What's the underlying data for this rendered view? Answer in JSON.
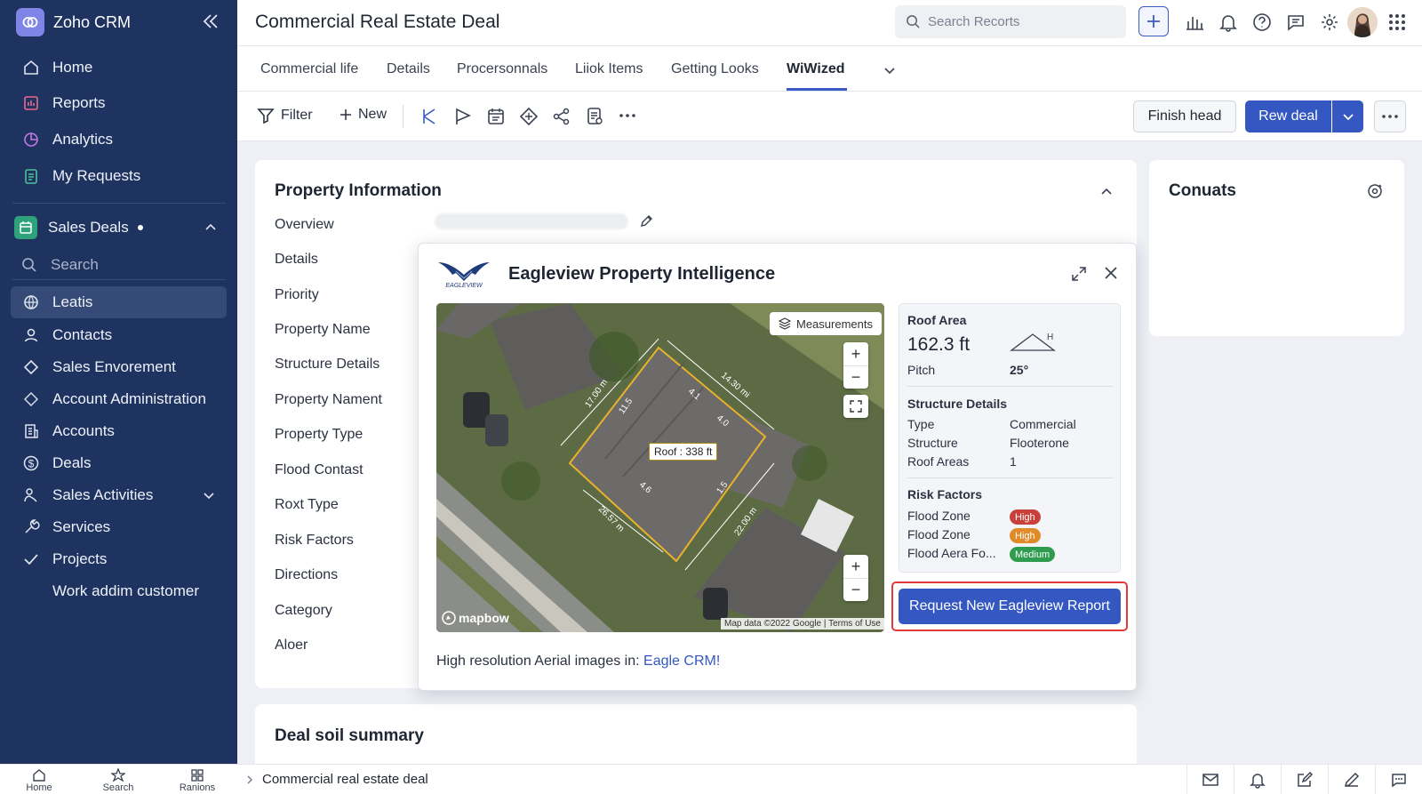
{
  "app": {
    "name": "Zoho CRM"
  },
  "sidebar": {
    "items": [
      {
        "label": "Home"
      },
      {
        "label": "Reports"
      },
      {
        "label": "Analytics"
      },
      {
        "label": "My Requests"
      }
    ],
    "section": {
      "label": "Sales Deals"
    },
    "search_placeholder": "Search",
    "module_items": [
      {
        "label": "Leatis"
      },
      {
        "label": "Contacts"
      },
      {
        "label": "Sales Envorement"
      },
      {
        "label": "Account Administration"
      },
      {
        "label": "Accounts"
      },
      {
        "label": "Deals"
      },
      {
        "label": "Sales Activities"
      },
      {
        "label": "Services"
      },
      {
        "label": "Projects"
      },
      {
        "label": "Work addim customer"
      }
    ]
  },
  "header": {
    "title": "Commercial Real Estate Deal",
    "search_placeholder": "Search Recorts"
  },
  "tabs": [
    {
      "label": "Commercial life"
    },
    {
      "label": "Details"
    },
    {
      "label": "Procersonnals"
    },
    {
      "label": "Liiok Items"
    },
    {
      "label": "Getting Looks"
    },
    {
      "label": "WiWized"
    }
  ],
  "toolbar": {
    "filter": "Filter",
    "new": "New",
    "finish_head": "Finish head",
    "rew_deal": "Rew deal"
  },
  "property_card": {
    "title": "Property Information",
    "fields": [
      "Overview",
      "Details",
      "Priority",
      "Property Name",
      "Structure Details",
      "Property Nament",
      "Property Type",
      "Flood Contast",
      "Roxt Type",
      "Risk Factors",
      "Directions",
      "Category",
      "Aloer"
    ]
  },
  "contacts_card": {
    "title": "Conuats"
  },
  "deal_summary": {
    "title": "Deal soil summary"
  },
  "modal": {
    "title": "Eagleview Property Intelligence",
    "logo_text": "EAGLEVIEW",
    "map": {
      "measurements": "Measurements",
      "roof_label": "Roof : 338 ft",
      "dims": [
        "14.30 mi",
        "17.00 m",
        "11.5",
        "4.1",
        "4.0",
        "4.6",
        "1.5",
        "22.00 m",
        "26.57 m"
      ],
      "brand": "mapbow",
      "attribution": "Map data ©2022 Google | Terms of Use"
    },
    "info": {
      "roof_area_label": "Roof Area",
      "roof_area_value": "162.3 ft",
      "pitch_label": "Pitch",
      "pitch_value": "25°",
      "pitch_marker": "H",
      "structure_title": "Structure Details",
      "structure": [
        {
          "label": "Type",
          "value": "Commercial"
        },
        {
          "label": "Structure",
          "value": "Flooterone"
        },
        {
          "label": "Roof Areas",
          "value": "1"
        }
      ],
      "risk_title": "Risk Factors",
      "risks": [
        {
          "label": "Flood Zone",
          "badge": "High",
          "color": "#c9403a"
        },
        {
          "label": "Flood Zone",
          "badge": "High",
          "color": "#e08a2a"
        },
        {
          "label": "Flood Aera Fo...",
          "badge": "Medium",
          "color": "#2e9b4e"
        }
      ]
    },
    "cta": "Request New Eagleview Report",
    "footer_text": "High resolution Aerial images in: ",
    "footer_link": "Eagle CRM!"
  },
  "bottom_nav": [
    {
      "label": "Home"
    },
    {
      "label": "Search"
    },
    {
      "label": "Ranions"
    }
  ],
  "statusbar": {
    "breadcrumb": "Commercial real estate deal"
  },
  "colors": {
    "sidebar": "#1f3361",
    "accent": "#3457c2",
    "highlight": "#e03a3a"
  }
}
